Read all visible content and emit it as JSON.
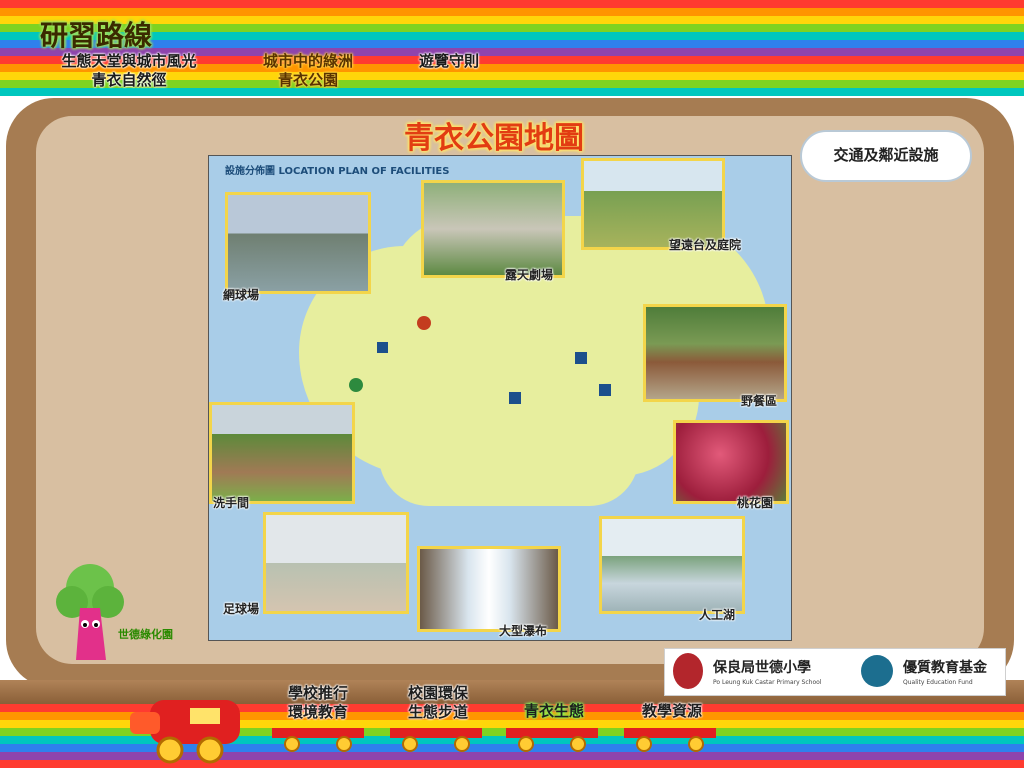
{
  "header": {
    "title": "研習路線",
    "nav": [
      {
        "label_1": "生態天堂與城市風光",
        "label_2": "青衣自然徑"
      },
      {
        "label_1": "城市中的綠洲",
        "label_2": "青衣公園"
      },
      {
        "label_1": "遊覽守則",
        "label_2": ""
      }
    ]
  },
  "main": {
    "map_title": "青衣公園地圖",
    "transport_cloud": "交通及鄰近設施",
    "map": {
      "header": "設施分佈圖 LOCATION PLAN OF FACILITIES",
      "labels": {
        "tennis": "網球場",
        "theatre": "露天劇場",
        "garden": "望遠台及庭院",
        "picnic": "野餐區",
        "peach": "桃花園",
        "toilet": "洗手間",
        "football": "足球場",
        "waterfall": "大型瀑布",
        "lake": "人工湖"
      }
    }
  },
  "mascot": {
    "label": "世德綠化園"
  },
  "logos": {
    "school_cn": "保良局世德小學",
    "school_en": "Po Leung Kuk Castar Primary School",
    "fund_cn": "優質教育基金",
    "fund_en": "Quality Education Fund"
  },
  "footer": {
    "nav": [
      {
        "label_1": "學校推行",
        "label_2": "環境教育"
      },
      {
        "label_1": "校園環保",
        "label_2": "生態步道"
      },
      {
        "label_1": "青衣生態",
        "label_2": ""
      },
      {
        "label_1": "教學資源",
        "label_2": ""
      }
    ]
  },
  "colors": {
    "board": "#a67c52",
    "board_inner": "#d8bfa1",
    "title_accent": "#e23d12",
    "map_water": "#a9cde8",
    "map_land": "#e7ee9e",
    "photo_frame": "#f3d54a"
  }
}
